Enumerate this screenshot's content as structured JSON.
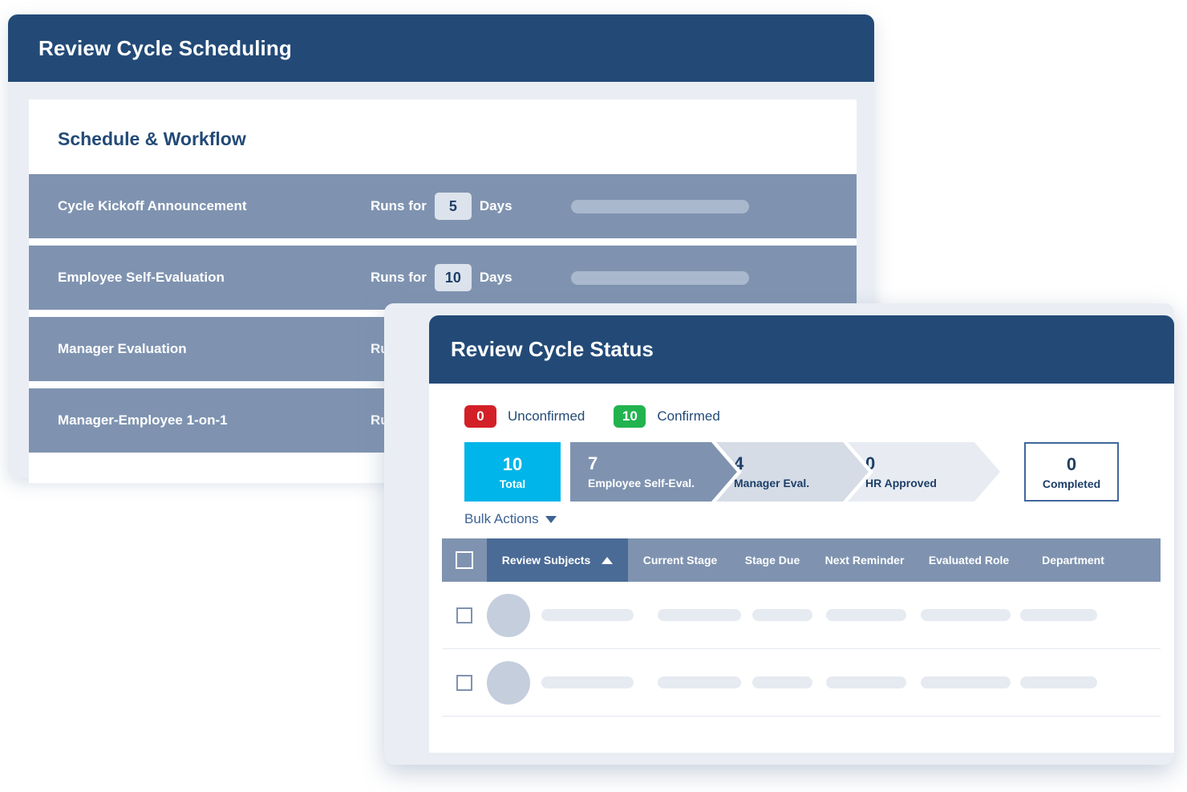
{
  "scheduling": {
    "title": "Review Cycle Scheduling",
    "card_title": "Schedule & Workflow",
    "duration_prefix": "Runs for",
    "duration_suffix": "Days",
    "rows": [
      {
        "name": "Cycle Kickoff Announcement",
        "days": "5"
      },
      {
        "name": "Employee Self-Evaluation",
        "days": "10"
      },
      {
        "name": "Manager Evaluation",
        "days": ""
      },
      {
        "name": "Manager-Employee 1-on-1",
        "days": ""
      }
    ]
  },
  "status": {
    "title": "Review Cycle Status",
    "confirmation": [
      {
        "count": "0",
        "label": "Unconfirmed",
        "color": "#d32027"
      },
      {
        "count": "10",
        "label": "Confirmed",
        "color": "#22b34f"
      }
    ],
    "funnel": [
      {
        "value": "10",
        "label": "Total",
        "color": "#00b5e9"
      },
      {
        "value": "7",
        "label": "Employee Self-Eval.",
        "color": "#7f93b0"
      },
      {
        "value": "4",
        "label": "Manager Eval.",
        "color": "#d5dce6"
      },
      {
        "value": "0",
        "label": "HR Approved",
        "color": "#e8ecf2"
      },
      {
        "value": "0",
        "label": "Completed",
        "color": "#ffffff"
      }
    ],
    "bulk_actions_label": "Bulk Actions",
    "table": {
      "columns": [
        "Review Subjects",
        "Current Stage",
        "Stage Due",
        "Next Reminder",
        "Evaluated Role",
        "Department"
      ],
      "sort_column": "Review Subjects",
      "sort_direction": "ascending",
      "rows": [
        {
          "placeholder": true
        },
        {
          "placeholder": true
        }
      ]
    }
  },
  "colors": {
    "header_blue": "#234a77",
    "row_slate": "#7f93b0",
    "accent_cyan": "#00b5e9",
    "panel_bg": "#eaeef4"
  }
}
